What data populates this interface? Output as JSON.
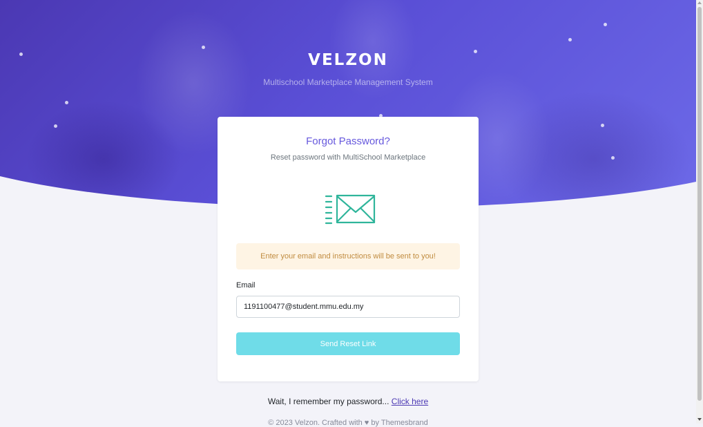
{
  "brand": {
    "logo": "VELZON",
    "tagline": "Multischool Marketplace Management System"
  },
  "card": {
    "title": "Forgot Password?",
    "subtitle": "Reset password with MultiSchool Marketplace",
    "icon": "mail-send-icon",
    "alert": "Enter your email and instructions will be sent to you!",
    "email_label": "Email",
    "email_value": "1191100477@student.mmu.edu.my",
    "submit_label": "Send Reset Link"
  },
  "remember": {
    "text": "Wait, I remember my password... ",
    "link": "Click here"
  },
  "footer": {
    "text": "© 2023 Velzon. Crafted with ♥ by Themesbrand"
  },
  "colors": {
    "hero_start": "#4b38b3",
    "hero_end": "#6d6ae8",
    "title": "#6658dd",
    "alert_bg": "#fef4e4",
    "alert_text": "#c08b3f",
    "button": "#6fdce8",
    "icon": "#2fb59b",
    "link": "#4b38b3"
  }
}
